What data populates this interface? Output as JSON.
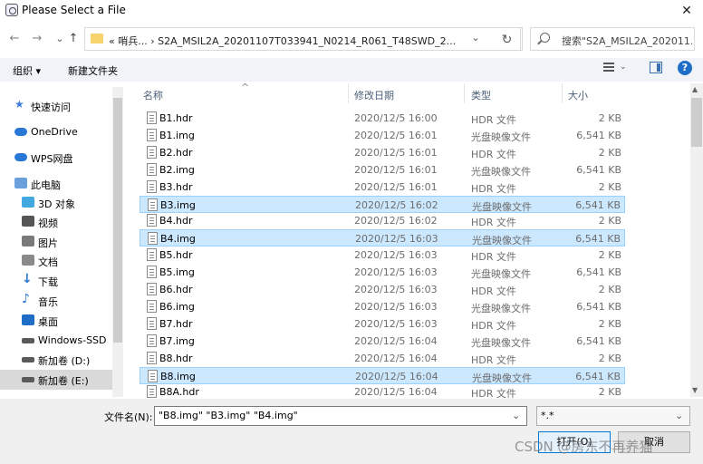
{
  "window": {
    "title": "Please Select a File",
    "close": "✕"
  },
  "address": {
    "back": "←",
    "forward": "→",
    "up": "↑",
    "path": "« 哨兵...  ›  S2A_MSIL2A_20201107T033941_N0214_R061_T48SWD_2...",
    "refresh": "↻",
    "dropdown": "⌄"
  },
  "search": {
    "placeholder": "搜索\"S2A_MSIL2A_202011..."
  },
  "toolbar": {
    "organize": "组织 ▾",
    "new_folder": "新建文件夹",
    "help": "?"
  },
  "nav": [
    {
      "label": "快速访问",
      "icon": "star-icon",
      "color": "#3b7dd8"
    },
    {
      "label": "OneDrive",
      "icon": "cloud-icon",
      "color": "#2a78d6"
    },
    {
      "label": "WPS网盘",
      "icon": "cloud-icon",
      "color": "#2a78d6"
    },
    {
      "label": "此电脑",
      "icon": "computer-icon",
      "color": "#6aa0dc"
    },
    {
      "label": "3D 对象",
      "icon": "cube-icon",
      "color": "#42a8e0"
    },
    {
      "label": "视频",
      "icon": "video-icon",
      "color": "#555555"
    },
    {
      "label": "图片",
      "icon": "picture-icon",
      "color": "#7a7a7a"
    },
    {
      "label": "文档",
      "icon": "document-icon",
      "color": "#8a8a8a"
    },
    {
      "label": "下载",
      "icon": "download-icon",
      "color": "#2a78d6"
    },
    {
      "label": "音乐",
      "icon": "music-icon",
      "color": "#2a78d6"
    },
    {
      "label": "桌面",
      "icon": "desktop-icon",
      "color": "#1e6dc6"
    },
    {
      "label": "Windows-SSD",
      "icon": "drive-icon",
      "color": "#5a5a5a"
    },
    {
      "label": "新加卷 (D:)",
      "icon": "drive-icon",
      "color": "#5a5a5a"
    },
    {
      "label": "新加卷 (E:)",
      "icon": "drive-icon",
      "color": "#5a5a5a"
    }
  ],
  "columns": {
    "name": "名称",
    "date": "修改日期",
    "type": "类型",
    "size": "大小",
    "sort": "^"
  },
  "files": [
    {
      "name": "B1.hdr",
      "date": "2020/12/5 16:00",
      "type": "HDR 文件",
      "size": "2 KB"
    },
    {
      "name": "B1.img",
      "date": "2020/12/5 16:01",
      "type": "光盘映像文件",
      "size": "6,541 KB"
    },
    {
      "name": "B2.hdr",
      "date": "2020/12/5 16:01",
      "type": "HDR 文件",
      "size": "2 KB"
    },
    {
      "name": "B2.img",
      "date": "2020/12/5 16:01",
      "type": "光盘映像文件",
      "size": "6,541 KB"
    },
    {
      "name": "B3.hdr",
      "date": "2020/12/5 16:01",
      "type": "HDR 文件",
      "size": "2 KB"
    },
    {
      "name": "B3.img",
      "date": "2020/12/5 16:02",
      "type": "光盘映像文件",
      "size": "6,541 KB",
      "selected": true
    },
    {
      "name": "B4.hdr",
      "date": "2020/12/5 16:02",
      "type": "HDR 文件",
      "size": "2 KB"
    },
    {
      "name": "B4.img",
      "date": "2020/12/5 16:03",
      "type": "光盘映像文件",
      "size": "6,541 KB",
      "selected": true
    },
    {
      "name": "B5.hdr",
      "date": "2020/12/5 16:03",
      "type": "HDR 文件",
      "size": "2 KB"
    },
    {
      "name": "B5.img",
      "date": "2020/12/5 16:03",
      "type": "光盘映像文件",
      "size": "6,541 KB"
    },
    {
      "name": "B6.hdr",
      "date": "2020/12/5 16:03",
      "type": "HDR 文件",
      "size": "2 KB"
    },
    {
      "name": "B6.img",
      "date": "2020/12/5 16:03",
      "type": "光盘映像文件",
      "size": "6,541 KB"
    },
    {
      "name": "B7.hdr",
      "date": "2020/12/5 16:03",
      "type": "HDR 文件",
      "size": "2 KB"
    },
    {
      "name": "B7.img",
      "date": "2020/12/5 16:04",
      "type": "光盘映像文件",
      "size": "6,541 KB"
    },
    {
      "name": "B8.hdr",
      "date": "2020/12/5 16:04",
      "type": "HDR 文件",
      "size": "2 KB"
    },
    {
      "name": "B8.img",
      "date": "2020/12/5 16:04",
      "type": "光盘映像文件",
      "size": "6,541 KB",
      "selected": true
    },
    {
      "name": "B8A.hdr",
      "date": "2020/12/5 16:04",
      "type": "HDR 文件",
      "size": "2 KB"
    }
  ],
  "bottom": {
    "filename_label": "文件名(N):",
    "filename_value": "\"B8.img\" \"B3.img\" \"B4.img\"",
    "filetype_value": "*.*",
    "open": "打开(O)",
    "cancel": "取消",
    "dropdown": "⌄"
  },
  "watermark": "CSDN @房东不再养猫"
}
